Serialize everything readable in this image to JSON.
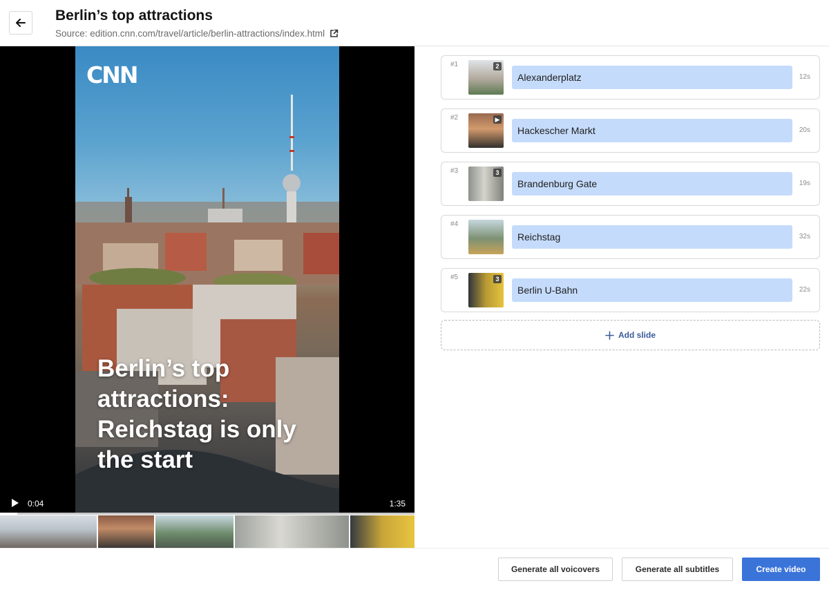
{
  "header": {
    "title": "Berlin’s top attractions",
    "source": "Source: edition.cnn.com/travel/article/berlin-attractions/index.html",
    "back_icon": "arrow-left-icon",
    "external_icon": "external-link-icon"
  },
  "video": {
    "logo": "CNN",
    "headline": "Berlin’s top attractions: Reichstag is only the start",
    "current_time": "0:04",
    "total_time": "1:35",
    "progress": 0.042
  },
  "slides": [
    {
      "num": "#1",
      "title": "Alexanderplatz",
      "duration": "12s",
      "badge": "2"
    },
    {
      "num": "#2",
      "title": "Hackescher Markt",
      "duration": "20s",
      "badge": "▶"
    },
    {
      "num": "#3",
      "title": "Brandenburg Gate",
      "duration": "19s",
      "badge": "3"
    },
    {
      "num": "#4",
      "title": "Reichstag",
      "duration": "32s",
      "badge": ""
    },
    {
      "num": "#5",
      "title": "Berlin U-Bahn",
      "duration": "22s",
      "badge": "3"
    }
  ],
  "add_slide": "Add slide",
  "footer": {
    "voiceovers": "Generate all voicovers",
    "subtitles": "Generate all subtitles",
    "create": "Create video"
  },
  "colors": {
    "accent": "#3b74d9",
    "slide_title_bg": "#c5dbfb"
  }
}
